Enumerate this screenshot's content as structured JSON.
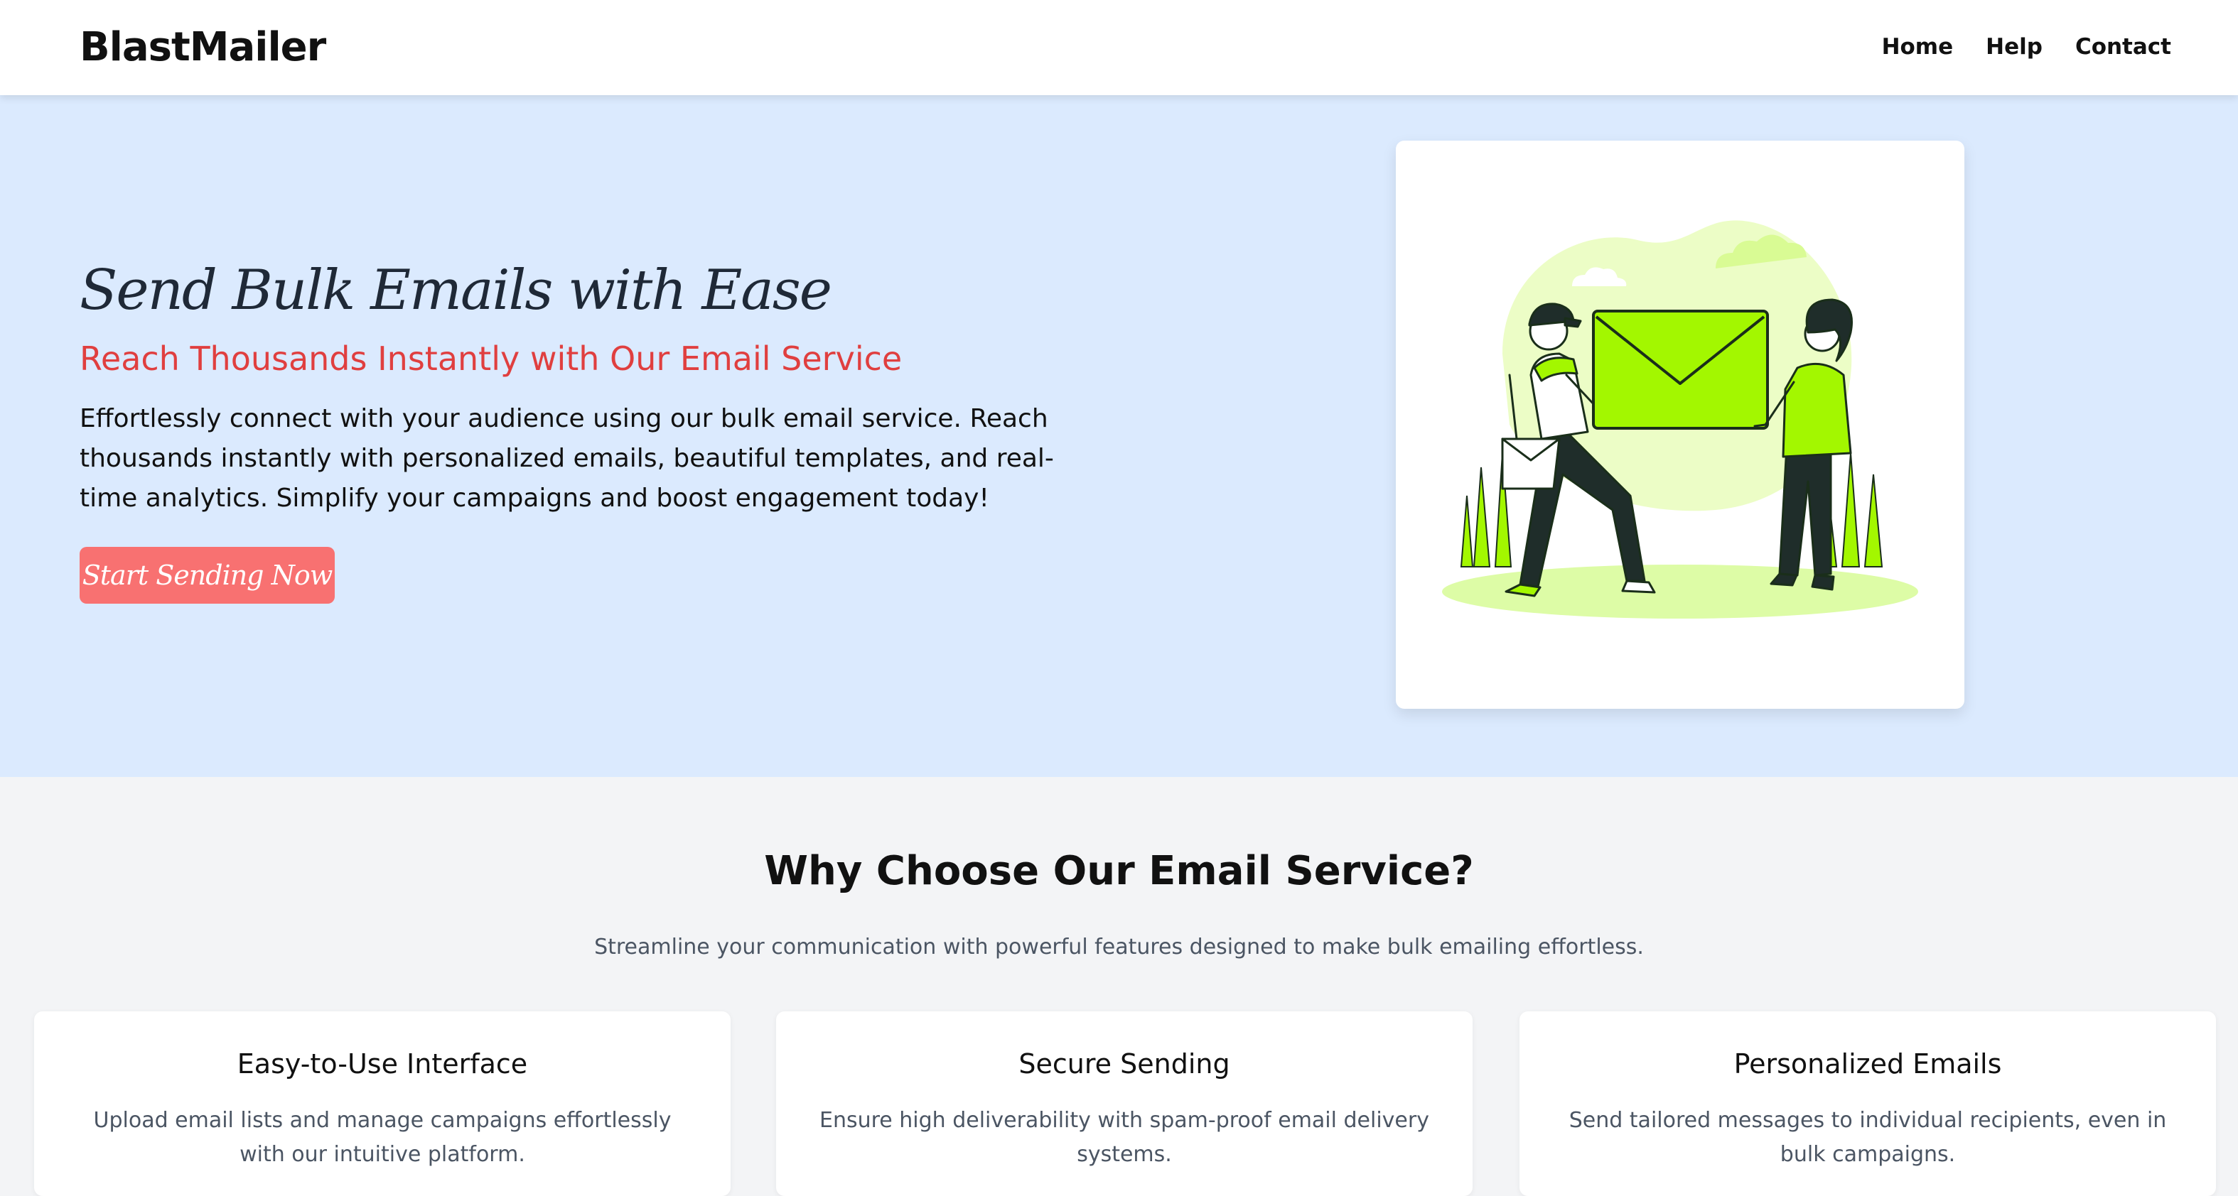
{
  "header": {
    "brand": "BlastMailer",
    "nav": [
      "Home",
      "Help",
      "Contact"
    ]
  },
  "hero": {
    "title": "Send Bulk Emails with Ease",
    "subtitle": "Reach Thousands Instantly with Our Email Service",
    "description": "Effortlessly connect with your audience using our bulk email service. Reach thousands instantly with personalized emails, beautiful templates, and real-time analytics. Simplify your campaigns and boost engagement today!",
    "cta_label": "Start Sending Now",
    "illustration_icon": "envelope-delivery-illustration"
  },
  "features": {
    "title": "Why Choose Our Email Service?",
    "subtitle": "Streamline your communication with powerful features designed to make bulk emailing effortless.",
    "cards": [
      {
        "title": "Easy-to-Use Interface",
        "text": "Upload email lists and manage campaigns effortlessly with our intuitive platform."
      },
      {
        "title": "Secure Sending",
        "text": "Ensure high deliverability with spam-proof email delivery systems."
      },
      {
        "title": "Personalized Emails",
        "text": "Send tailored messages to individual recipients, even in bulk campaigns."
      }
    ]
  },
  "colors": {
    "hero_bg": "#dbeafe",
    "accent_red": "#e03f3f",
    "cta_bg": "#f87171",
    "illustration_green": "#a3f700",
    "page_bg": "#f3f4f6"
  }
}
